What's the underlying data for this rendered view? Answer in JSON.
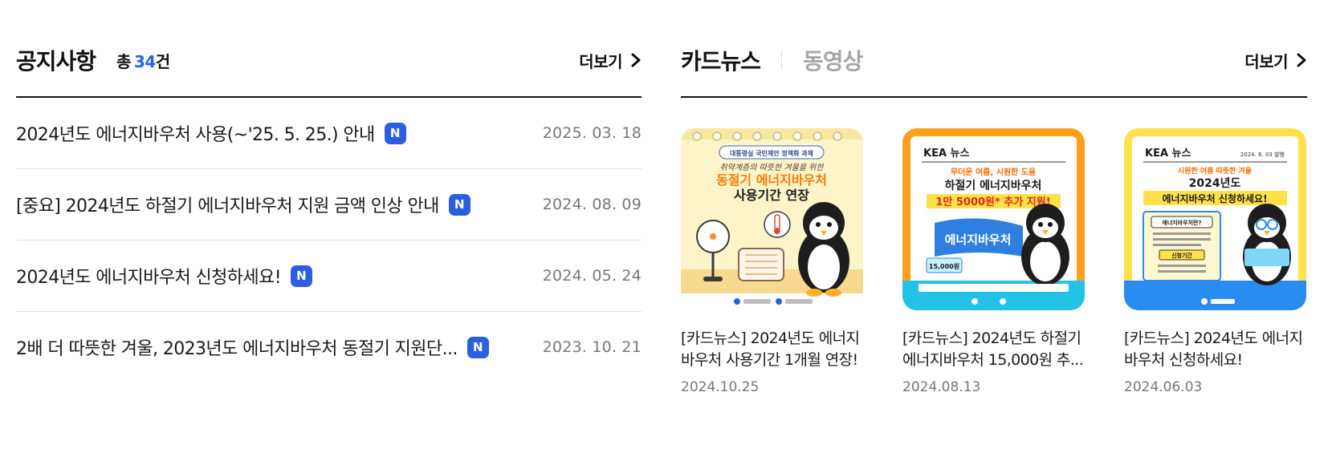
{
  "notice": {
    "title": "공지사항",
    "count_prefix": "총",
    "count_num": "34",
    "count_suffix": "건",
    "more_label": "더보기",
    "new_badge": "N",
    "items": [
      {
        "title": "2024년도 에너지바우처 사용(~'25. 5. 25.) 안내",
        "date": "2025. 03. 18"
      },
      {
        "title": "[중요] 2024년도 하절기 에너지바우처 지원 금액 인상 안내",
        "date": "2024. 08. 09"
      },
      {
        "title": "2024년도 에너지바우처 신청하세요!",
        "date": "2024. 05. 24"
      },
      {
        "title": "2배 더 따뜻한 겨울, 2023년도 에너지바우처 동절기 지원단...",
        "date": "2023. 10. 21"
      }
    ]
  },
  "cardnews": {
    "tab_active": "카드뉴스",
    "tab_inactive": "동영상",
    "more_label": "더보기",
    "items": [
      {
        "title": "[카드뉴스] 2024년도 에너지바우처 사용기간 1개월 연장!",
        "date": "2024.10.25",
        "thumb": {
          "pill": "대통령실 국민제안 정책화 과제",
          "script": "취약계층의 따뜻한 겨울을 위한",
          "line1": "동절기 에너지바우처",
          "line2": "사용기간 연장"
        }
      },
      {
        "title": "[카드뉴스] 2024년도 하절기 에너지바우처 15,000원 추...",
        "date": "2024.08.13",
        "thumb": {
          "brand": "KEA 뉴스",
          "sub": "무더운 여름, 시원한 도움",
          "line1": "하절기 에너지바우처",
          "line2": "1만 5000원* 추가 지원!",
          "banner": "에너지바우처",
          "price": "15,000원"
        }
      },
      {
        "title": "[카드뉴스] 2024년도 에너지바우처 신청하세요!",
        "date": "2024.06.03",
        "thumb": {
          "brand": "KEA 뉴스",
          "pubdate": "2024. 6. 03 발행",
          "sub": "시원한 여름 따뜻한 겨울",
          "line1": "2024년도",
          "line2": "에너지바우처 신청하세요!",
          "q": "에너지바우처란?",
          "period_label": "신청기간"
        }
      }
    ]
  },
  "colors": {
    "accent": "#2563eb",
    "badge": "#2c5fe0",
    "muted": "#777777"
  }
}
